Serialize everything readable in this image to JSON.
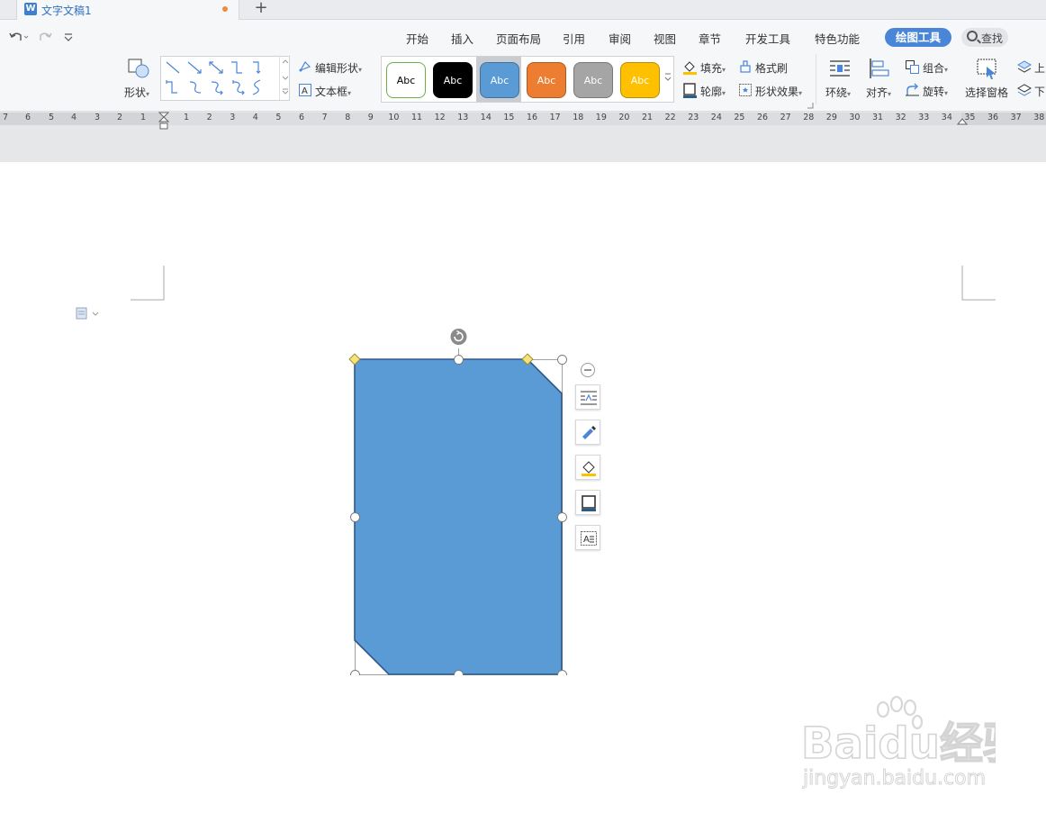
{
  "titlebar": {
    "doc_icon": "W",
    "doc_title": "文字文稿1",
    "new_tab": "+"
  },
  "quick_access": {
    "undo_icon": "undo-icon",
    "redo_icon": "redo-icon",
    "customize_icon": "customize-icon"
  },
  "menu": {
    "items": [
      "开始",
      "插入",
      "页面布局",
      "引用",
      "审阅",
      "视图",
      "章节",
      "开发工具",
      "特色功能"
    ],
    "active": "绘图工具",
    "search_label": "查找"
  },
  "ribbon": {
    "shape_label": "形状",
    "edit_shape_label": "编辑形状",
    "textbox_label": "文本框",
    "styles": [
      {
        "label": "Abc",
        "bg": "#ffffff",
        "border": "#70ad47",
        "color": "#000000"
      },
      {
        "label": "Abc",
        "bg": "#000000",
        "border": "#000000",
        "color": "#ffffff"
      },
      {
        "label": "Abc",
        "bg": "#5b9bd5",
        "border": "#41719c",
        "color": "#ffffff"
      },
      {
        "label": "Abc",
        "bg": "#ed7d31",
        "border": "#ae5a21",
        "color": "#ffffff"
      },
      {
        "label": "Abc",
        "bg": "#a5a5a5",
        "border": "#787878",
        "color": "#ffffff"
      },
      {
        "label": "Abc",
        "bg": "#ffc000",
        "border": "#bc8c00",
        "color": "#ffffff"
      }
    ],
    "fill_label": "填充",
    "format_painter_label": "格式刷",
    "outline_label": "轮廓",
    "shape_effects_label": "形状效果",
    "wrap_label": "环绕",
    "align_label": "对齐",
    "group_label": "组合",
    "rotate_label": "旋转",
    "selection_pane_label": "选择窗格",
    "bring_forward_label": "上",
    "send_backward_label": "下"
  },
  "ruler": {
    "left_numbers": [
      "7",
      "6",
      "5",
      "4",
      "3",
      "2",
      "1"
    ],
    "right_numbers": [
      "1",
      "2",
      "3",
      "4",
      "5",
      "6",
      "7",
      "8",
      "9",
      "10",
      "11",
      "12",
      "13",
      "14",
      "15",
      "16",
      "17",
      "18",
      "19",
      "20",
      "21",
      "22",
      "23",
      "24",
      "25",
      "26",
      "27",
      "28",
      "29",
      "30",
      "31",
      "32",
      "33",
      "34",
      "35",
      "36",
      "37",
      "38"
    ]
  },
  "shape": {
    "fill": "#5b9bd5",
    "stroke": "#2e5a88"
  },
  "float_toolbar": {
    "collapse_icon": "minus-circle-icon",
    "buttons": [
      "wrap-text-icon",
      "shape-style-icon",
      "fill-icon",
      "outline-icon",
      "textbox-icon"
    ]
  },
  "watermark": {
    "brand": "Baidu经验",
    "url": "jingyan.baidu.com"
  }
}
